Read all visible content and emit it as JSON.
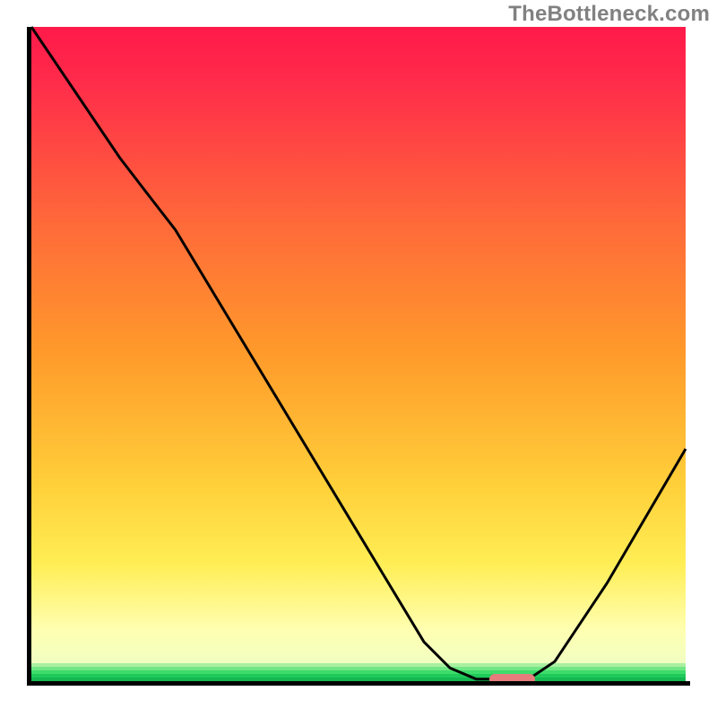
{
  "watermark": "TheBottleneck.com",
  "chart_data": {
    "type": "line",
    "title": "",
    "xlabel": "",
    "ylabel": "",
    "x_range": [
      0,
      1
    ],
    "y_range": [
      0,
      1
    ],
    "curve": [
      {
        "x": 0.0,
        "y": 1.0
      },
      {
        "x": 0.135,
        "y": 0.8
      },
      {
        "x": 0.185,
        "y": 0.735
      },
      {
        "x": 0.22,
        "y": 0.69
      },
      {
        "x": 0.6,
        "y": 0.06
      },
      {
        "x": 0.64,
        "y": 0.02
      },
      {
        "x": 0.68,
        "y": 0.003
      },
      {
        "x": 0.76,
        "y": 0.003
      },
      {
        "x": 0.8,
        "y": 0.03
      },
      {
        "x": 0.88,
        "y": 0.15
      },
      {
        "x": 1.0,
        "y": 0.355
      }
    ],
    "marker_x_range": [
      0.7,
      0.77
    ],
    "gradient_top_color": "#ff1a4a",
    "gradient_mid_color": "#ff9b2b",
    "gradient_yellow_color": "#ffee55",
    "gradient_pale_color": "#ffffb0",
    "green_band_colors": [
      "#aaf0a1",
      "#71e784",
      "#3edc6b",
      "#1fc95a",
      "#14b750"
    ],
    "green_band_start_y": 0.972,
    "green_band_end_y": 1.0
  }
}
